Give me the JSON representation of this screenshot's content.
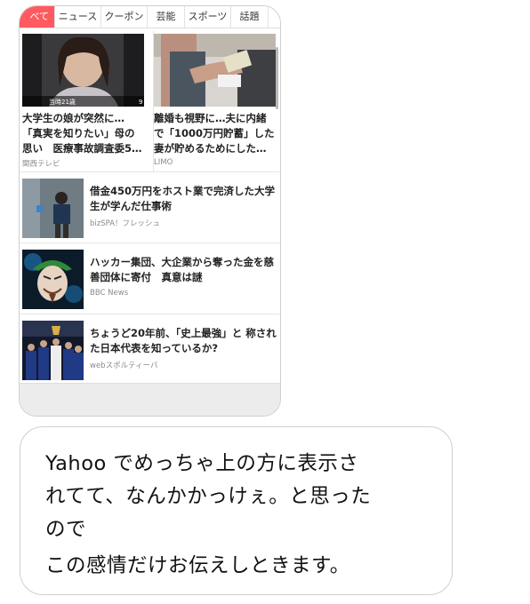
{
  "tabs": [
    {
      "label": "べて",
      "active": true
    },
    {
      "label": "ニュース",
      "active": false
    },
    {
      "label": "クーポン",
      "active": false
    },
    {
      "label": "芸能",
      "active": false
    },
    {
      "label": "スポーツ",
      "active": false
    },
    {
      "label": "話題",
      "active": false
    },
    {
      "label": "",
      "active": false
    }
  ],
  "top_cards": [
    {
      "title": "大学生の娘が突然に…「真実を知りたい」母の思い　医療事故調査委5…",
      "source": "関西テレビ",
      "image_caption": "当時21歳",
      "image_badge": "9"
    },
    {
      "title": "離婚も視野に…夫に内緒で「1000万円貯蓄」した妻が貯めるためにした…",
      "source": "LIMO"
    }
  ],
  "list_items": [
    {
      "title": "借金450万円をホスト業で完済した大学生が学んだ仕事術",
      "source": "bizSPA！フレッシュ"
    },
    {
      "title": "ハッカー集団、大企業から奪った金を慈善団体に寄付　真意は謎",
      "source": "BBC News"
    },
    {
      "title": "ちょうど20年前、「史上最強」と 称された日本代表を知っているか?",
      "source": "webスポルティーバ"
    }
  ],
  "message": {
    "lines": [
      "Yahoo でめっちゃ上の方に表示さ",
      "れてて、なんかかっけぇ。と思った",
      "ので",
      "この感情だけお伝えしときます。"
    ]
  },
  "colors": {
    "active_tab": "#ff5a5f",
    "source_text": "#8a8a8a"
  }
}
